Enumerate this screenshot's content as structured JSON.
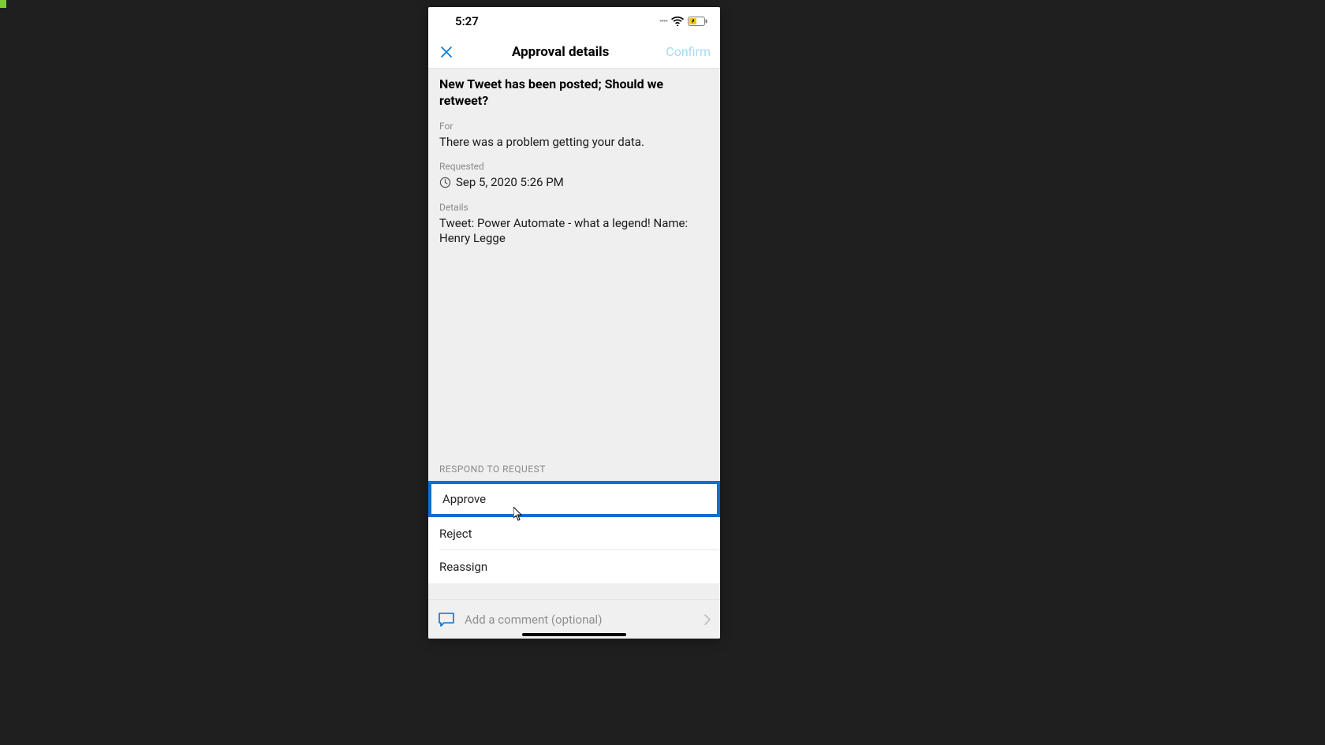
{
  "status": {
    "time": "5:27"
  },
  "nav": {
    "title": "Approval details",
    "confirm": "Confirm"
  },
  "details": {
    "title": "New Tweet has been posted; Should we retweet?",
    "for_label": "For",
    "for_value": "There was a problem getting your data.",
    "requested_label": "Requested",
    "requested_value": "Sep 5, 2020 5:26 PM",
    "details_label": "Details",
    "details_value": "Tweet: Power Automate - what a legend! Name: Henry Legge"
  },
  "respond": {
    "label": "RESPOND TO REQUEST",
    "options": {
      "approve": "Approve",
      "reject": "Reject",
      "reassign": "Reassign"
    }
  },
  "comment": {
    "placeholder": "Add a comment (optional)"
  }
}
